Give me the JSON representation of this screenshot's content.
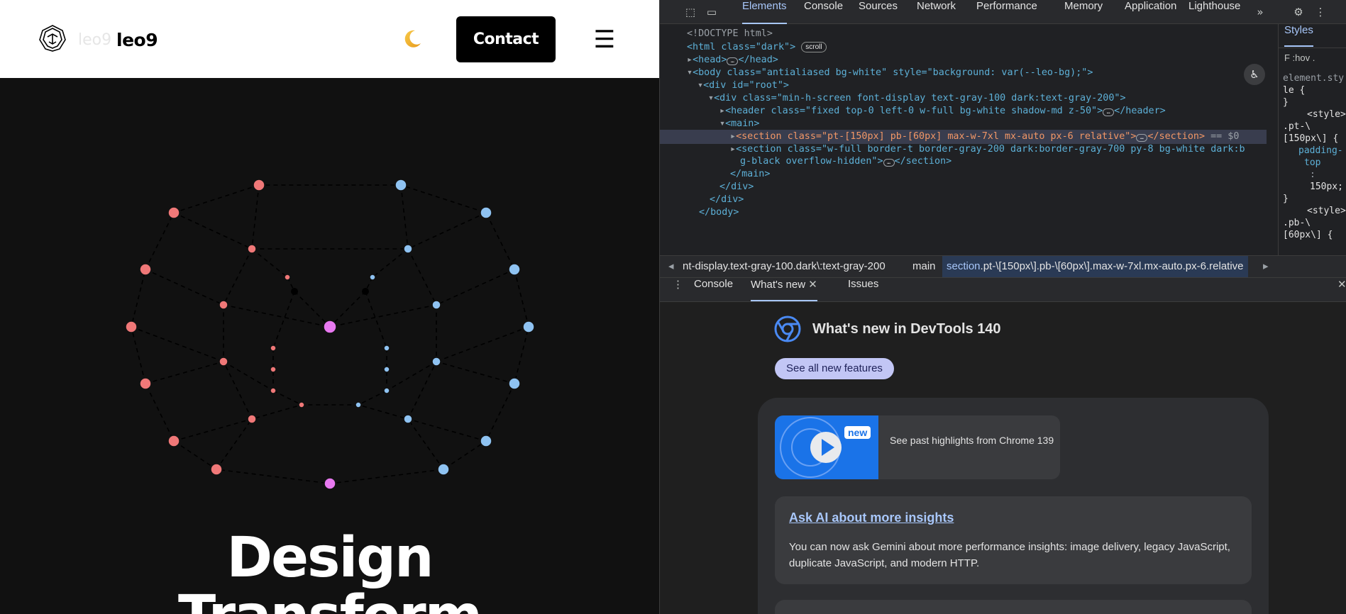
{
  "site": {
    "logo_ghost": "leo9",
    "logo_text": "leo9",
    "contact_label": "Contact",
    "menu_glyph": "☰",
    "theme_icon": "moon-icon",
    "hero_line1": "Design",
    "hero_line2": "Transform",
    "colors": {
      "header_bg": "#ffffff",
      "page_bg": "#111111",
      "node_red": "#f07878",
      "node_blue": "#8fc3f2",
      "node_pink": "#e879f0"
    }
  },
  "devtools": {
    "tabs": [
      "Elements",
      "Console",
      "Sources",
      "Network",
      "Performance",
      "Memory",
      "Application",
      "Lighthouse"
    ],
    "active_tab": "Elements",
    "dom": {
      "doctype": "<!DOCTYPE html>",
      "html_open": "<html class=\"dark\">",
      "scroll_pill": "scroll",
      "head": "<head>",
      "head_close": "</head>",
      "body_open": "<body class=\"antialiased bg-white\" style=\"background: var(--leo-bg);\">",
      "root_open": "<div id=\"root\">",
      "minh_open": "<div class=\"min-h-screen font-display text-gray-100 dark:text-gray-200\">",
      "header": "<header class=\"fixed top-0 left-0 w-full bg-white shadow-md z-50\">",
      "header_close": "</header>",
      "main_open": "<main>",
      "section1": "<section class=\"pt-[150px] pb-[60px] max-w-7xl mx-auto px-6 relative\">",
      "section1_close": "</section>",
      "section1_marker": "== $0",
      "section2_a": "<section class=\"w-full border-t border-gray-200 dark:border-gray-700 py-8 bg-white dark:b",
      "section2_b": "g-black overflow-hidden\">",
      "section2_close": "</section>",
      "main_close": "</main>",
      "div_close1": "</div>",
      "div_close2": "</div>",
      "body_close": "</body>",
      "dots": "…"
    },
    "styles": {
      "tab": "Styles",
      "filter": "F :hov .",
      "lines": [
        "element.sty",
        "le {",
        "}",
        "<style>",
        ".pt-\\",
        "[150px\\] {",
        "padding-",
        "top",
        ":",
        "150px;",
        "}",
        "<style>",
        ".pb-\\",
        "[60px\\] {"
      ]
    },
    "breadcrumbs": {
      "c1": "nt-display.text-gray-100.dark\\:text-gray-200",
      "c2": "main",
      "c3_tag": "section",
      "c3_rest": ".pt-\\[150px\\].pb-\\[60px\\].max-w-7xl.mx-auto.px-6.relative"
    },
    "drawer_tabs": {
      "console": "Console",
      "whats_new": "What's new",
      "issues": "Issues"
    },
    "whats_new": {
      "title": "What's new in DevTools 140",
      "see_all": "See all new features",
      "badge": "new",
      "video_text": "See past highlights from Chrome 139",
      "item_title": "Ask AI about more insights",
      "item_body": "You can now ask Gemini about more performance insights: image delivery, legacy JavaScript, duplicate JavaScript, and modern HTTP."
    }
  }
}
